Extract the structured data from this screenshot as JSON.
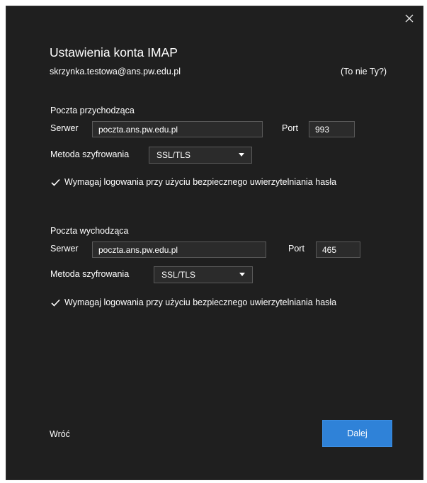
{
  "dialog": {
    "title": "Ustawienia konta IMAP",
    "email": "skrzynka.testowa@ans.pw.edu.pl",
    "not_you": "(To nie Ty?)"
  },
  "incoming": {
    "section_label": "Poczta przychodząca",
    "server_label": "Serwer",
    "server_value": "poczta.ans.pw.edu.pl",
    "port_label": "Port",
    "port_value": "993",
    "encryption_label": "Metoda szyfrowania",
    "encryption_value": "SSL/TLS",
    "secure_auth_label": "Wymagaj logowania przy użyciu bezpiecznego uwierzytelniania hasła",
    "secure_auth_checked": true
  },
  "outgoing": {
    "section_label": "Poczta wychodząca",
    "server_label": "Serwer",
    "server_value": "poczta.ans.pw.edu.pl",
    "port_label": "Port",
    "port_value": "465",
    "encryption_label": "Metoda szyfrowania",
    "encryption_value": "SSL/TLS",
    "secure_auth_label": "Wymagaj logowania przy użyciu bezpiecznego uwierzytelniania hasła",
    "secure_auth_checked": true
  },
  "footer": {
    "back_label": "Wróć",
    "next_label": "Dalej"
  },
  "colors": {
    "background": "#1f1f1f",
    "input_background": "#2b2b2b",
    "accent": "#2f82d8"
  }
}
